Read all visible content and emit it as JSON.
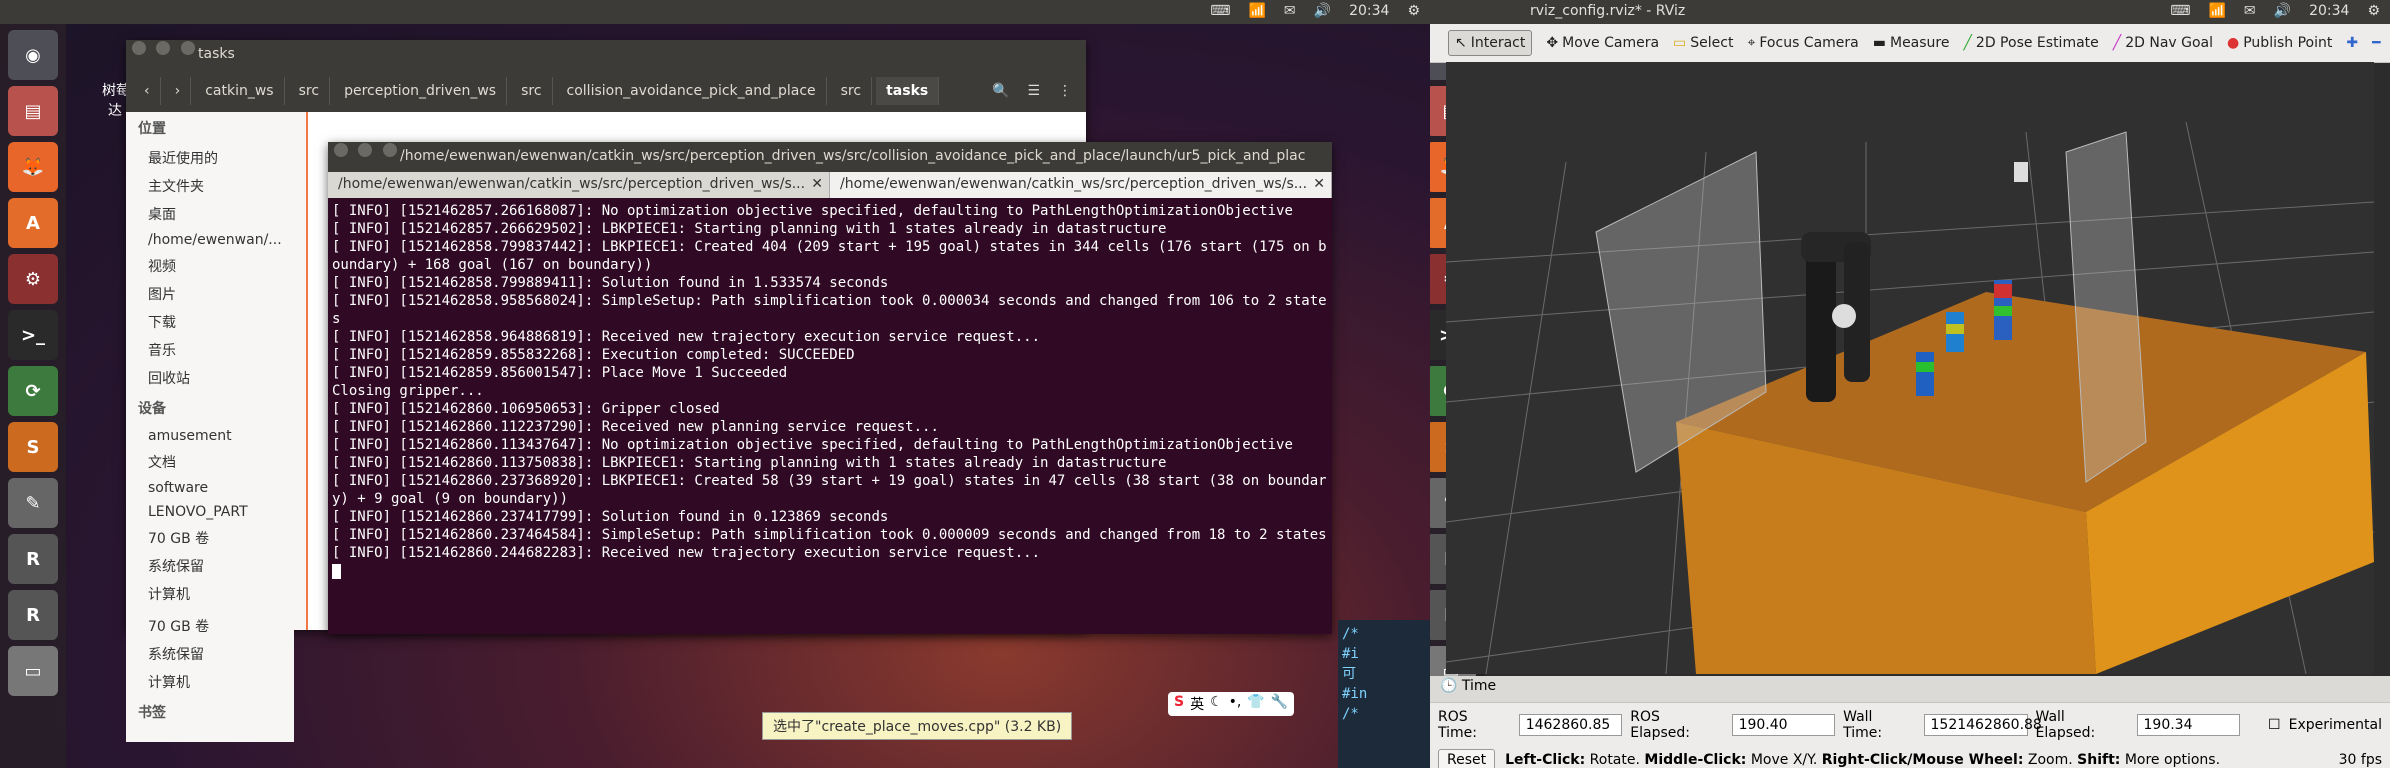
{
  "left_screen": {
    "topbar": {
      "time": "20:34"
    },
    "file_manager": {
      "title": "tasks",
      "breadcrumbs": [
        "catkin_ws",
        "src",
        "perception_driven_ws",
        "src",
        "collision_avoidance_pick_and_place",
        "src",
        "tasks"
      ],
      "sidebar": {
        "places_header": "位置",
        "places": [
          "最近使用的",
          "主文件夹",
          "桌面",
          "/home/ewenwan/...",
          "视频",
          "图片",
          "下载",
          "音乐",
          "回收站"
        ],
        "devices_header": "设备",
        "devices": [
          "amusement",
          "文档",
          "software",
          "LENOVO_PART",
          "70 GB 卷",
          "系统保留",
          "计算机"
        ],
        "bookmarks_header": "书签",
        "extra": [
          "70 GB 卷",
          "系统保留",
          "计算机"
        ],
        "extra_header": "书签"
      },
      "bg_text": [
        "树莓",
        "达"
      ]
    },
    "terminal": {
      "title": "/home/ewenwan/ewenwan/catkin_ws/src/perception_driven_ws/src/collision_avoidance_pick_and_place/launch/ur5_pick_and_plac",
      "tabs": [
        "/home/ewenwan/ewenwan/catkin_ws/src/perception_driven_ws/s...",
        "/home/ewenwan/ewenwan/catkin_ws/src/perception_driven_ws/s..."
      ],
      "lines": [
        "[ INFO] [1521462857.266168087]: No optimization objective specified, defaulting to PathLengthOptimizationObjective",
        "[ INFO] [1521462857.266629502]: LBKPIECE1: Starting planning with 1 states already in datastructure",
        "[ INFO] [1521462858.799837442]: LBKPIECE1: Created 404 (209 start + 195 goal) states in 344 cells (176 start (175 on boundary) + 168 goal (167 on boundary))",
        "[ INFO] [1521462858.799889411]: Solution found in 1.533574 seconds",
        "[ INFO] [1521462858.958568024]: SimpleSetup: Path simplification took 0.000034 seconds and changed from 106 to 2 states",
        "[ INFO] [1521462858.964886819]: Received new trajectory execution service request...",
        "[ INFO] [1521462859.855832268]: Execution completed: SUCCEEDED",
        "[ INFO] [1521462859.856001547]: Place Move 1 Succeeded",
        "Closing gripper...",
        "[ INFO] [1521462860.106950653]: Gripper closed",
        "[ INFO] [1521462860.112237290]: Received new planning service request...",
        "[ INFO] [1521462860.113437647]: No optimization objective specified, defaulting to PathLengthOptimizationObjective",
        "[ INFO] [1521462860.113750838]: LBKPIECE1: Starting planning with 1 states already in datastructure",
        "[ INFO] [1521462860.237368920]: LBKPIECE1: Created 58 (39 start + 19 goal) states in 47 cells (38 start (38 on boundary) + 9 goal (9 on boundary))",
        "[ INFO] [1521462860.237417799]: Solution found in 0.123869 seconds",
        "[ INFO] [1521462860.237464584]: SimpleSetup: Path simplification took 0.000009 seconds and changed from 18 to 2 states",
        "[ INFO] [1521462860.244682283]: Received new trajectory execution service request..."
      ]
    },
    "tooltip": "选中了\"create_place_moves.cpp\" (3.2 KB)",
    "ime_label": "英"
  },
  "right_screen": {
    "window_title": "rviz_config.rviz* - RViz",
    "time": "20:34",
    "toolbar": [
      "Interact",
      "Move Camera",
      "Select",
      "Focus Camera",
      "Measure",
      "2D Pose Estimate",
      "2D Nav Goal",
      "Publish Point"
    ],
    "time_panel": {
      "title": "Time",
      "ros_time_label": "ROS Time:",
      "ros_time": "1462860.85",
      "ros_elapsed_label": "ROS Elapsed:",
      "ros_elapsed": "190.40",
      "wall_time_label": "Wall Time:",
      "wall_time": "1521462860.88",
      "wall_elapsed_label": "Wall Elapsed:",
      "wall_elapsed": "190.34",
      "experimental_label": "Experimental"
    },
    "status": {
      "reset": "Reset",
      "hint_bold1": "Left-Click:",
      "hint1": "Rotate.",
      "hint_bold2": "Middle-Click:",
      "hint2": "Move X/Y.",
      "hint_bold3": "Right-Click/Mouse Wheel:",
      "hint3": "Zoom.",
      "hint_bold4": "Shift:",
      "hint4": "More options.",
      "fps": "30 fps"
    },
    "editor_snippet": [
      "/*",
      "#i",
      "可",
      "#in",
      "/*"
    ]
  }
}
